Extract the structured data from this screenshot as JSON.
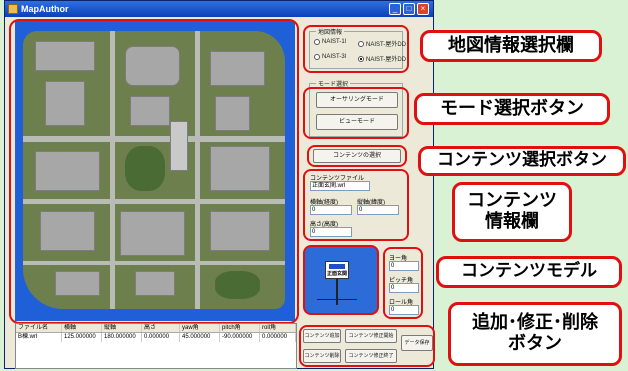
{
  "window": {
    "title": "MapAuthor",
    "buttons": [
      "_",
      "□",
      "×"
    ]
  },
  "map_group": {
    "title": "地図情報",
    "options": [
      {
        "label": "NAIST-1l",
        "selected": false
      },
      {
        "label": "NAIST-屋外DD",
        "selected": false
      },
      {
        "label": "NAIST-3l",
        "selected": false
      },
      {
        "label": "NAIST-屋外DD",
        "selected": true
      }
    ]
  },
  "mode_group": {
    "title": "モード選択",
    "buttons": [
      "オーサリングモード",
      "ビューモード"
    ]
  },
  "content_select_button": "コンテンツの選択",
  "content_info": {
    "file_label": "コンテンツファイル",
    "file_value": "正面玄関.wrl",
    "lon_label": "横軸(経度)",
    "lon_value": "0",
    "lat_label": "縦軸(緯度)",
    "lat_value": "0",
    "alt_label": "高さ(高度)",
    "alt_value": "0"
  },
  "model": {
    "sign_text": "正面玄関"
  },
  "angles": {
    "yaw_label": "ヨー角",
    "yaw_value": "0",
    "pitch_label": "ピッチ角",
    "pitch_value": "0",
    "roll_label": "ロール角",
    "roll_value": "0"
  },
  "action_buttons": [
    "コンテンツ追加",
    "コンテンツ修正開始",
    "データ保存",
    "コンテンツ削除",
    "コンテンツ修正終了"
  ],
  "table": {
    "headers": [
      "ファイル名",
      "横軸",
      "縦軸",
      "高さ",
      "yaw角",
      "pitch角",
      "roll角"
    ],
    "rows": [
      [
        "B棟.wrl",
        "125.000000",
        "180.000000",
        "0.000000",
        "45.000000",
        "-90.000000",
        "0.000000"
      ]
    ]
  },
  "callouts": {
    "map_info": "地図情報選択欄",
    "mode": "モード選択ボタン",
    "content_select": "コンテンツ選択ボタン",
    "content_info": "コンテンツ\n情報欄",
    "content_model": "コンテンツモデル",
    "edit": "追加･修正･削除\nボタン"
  },
  "colors": {
    "callout_border": "#e01010",
    "map_water": "#1f5fd8",
    "background": "#d9f2d3"
  }
}
